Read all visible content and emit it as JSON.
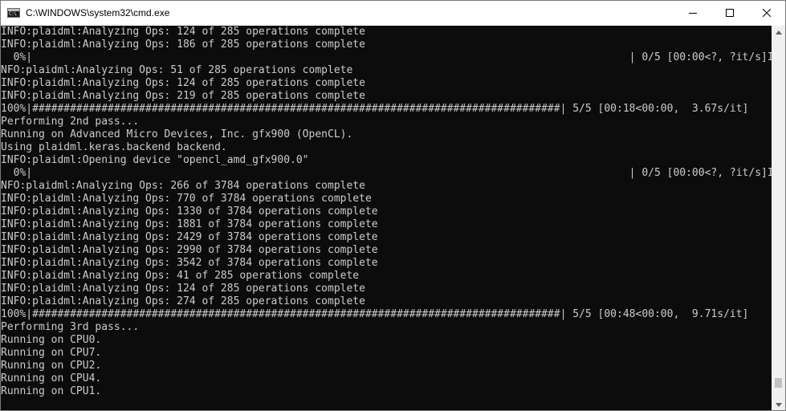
{
  "window": {
    "title": "C:\\WINDOWS\\system32\\cmd.exe",
    "icon": "cmd-icon",
    "icon_prompt": "C:\\"
  },
  "controls": {
    "minimize_icon": "minimize-icon",
    "maximize_icon": "maximize-icon",
    "close_icon": "close-icon"
  },
  "console": {
    "lines": [
      "INFO:plaidml:Analyzing Ops: 124 of 285 operations complete",
      "INFO:plaidml:Analyzing Ops: 186 of 285 operations complete",
      "  0%|                                                                                               | 0/5 [00:00<?, ?it/s]I",
      "NFO:plaidml:Analyzing Ops: 51 of 285 operations complete",
      "INFO:plaidml:Analyzing Ops: 124 of 285 operations complete",
      "INFO:plaidml:Analyzing Ops: 219 of 285 operations complete",
      "100%|####################################################################################| 5/5 [00:18<00:00,  3.67s/it]",
      "Performing 2nd pass...",
      "Running on Advanced Micro Devices, Inc. gfx900 (OpenCL).",
      "Using plaidml.keras.backend backend.",
      "INFO:plaidml:Opening device \"opencl_amd_gfx900.0\"",
      "  0%|                                                                                               | 0/5 [00:00<?, ?it/s]I",
      "NFO:plaidml:Analyzing Ops: 266 of 3784 operations complete",
      "INFO:plaidml:Analyzing Ops: 770 of 3784 operations complete",
      "INFO:plaidml:Analyzing Ops: 1330 of 3784 operations complete",
      "INFO:plaidml:Analyzing Ops: 1881 of 3784 operations complete",
      "INFO:plaidml:Analyzing Ops: 2429 of 3784 operations complete",
      "INFO:plaidml:Analyzing Ops: 2990 of 3784 operations complete",
      "INFO:plaidml:Analyzing Ops: 3542 of 3784 operations complete",
      "INFO:plaidml:Analyzing Ops: 41 of 285 operations complete",
      "INFO:plaidml:Analyzing Ops: 124 of 285 operations complete",
      "INFO:plaidml:Analyzing Ops: 274 of 285 operations complete",
      "100%|####################################################################################| 5/5 [00:48<00:00,  9.71s/it]",
      "Performing 3rd pass...",
      "Running on CPU0.",
      "Running on CPU7.",
      "Running on CPU2.",
      "Running on CPU4.",
      "Running on CPU1.",
      ""
    ]
  },
  "scrollbar": {
    "up_icon": "scroll-up-arrow-icon",
    "down_icon": "scroll-down-arrow-icon",
    "position": 0.97
  },
  "colors": {
    "console_bg": "#0c0c0c",
    "console_text": "#cccccc",
    "titlebar_bg": "#ffffff",
    "scrollbar_track": "#f0f0f0",
    "scrollbar_thumb": "#c1c1c1"
  }
}
